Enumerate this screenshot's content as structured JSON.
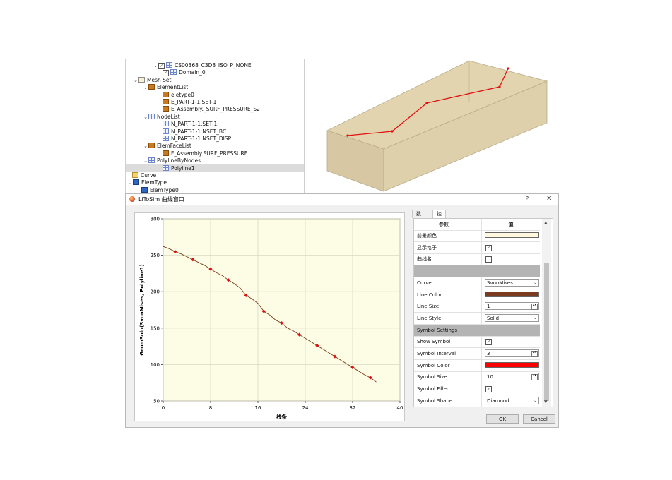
{
  "tree": {
    "items": [
      {
        "label": "CS00368_C3D8_ISO_P_NONE",
        "icon": "grid-icon",
        "checked": true,
        "expanded": true
      },
      {
        "label": "Domain_0",
        "icon": "grid-icon",
        "checked": true
      },
      {
        "label": "Mesh Set",
        "icon": "folder-icon",
        "expanded": true
      },
      {
        "label": "ElementList",
        "icon": "book-icon",
        "expanded": true
      },
      {
        "label": "eletype0",
        "icon": "book-icon"
      },
      {
        "label": "E_PART-1-1.SET-1",
        "icon": "book-icon"
      },
      {
        "label": "E_Assembly._SURF_PRESSURE_S2",
        "icon": "book-icon"
      },
      {
        "label": "NodeList",
        "icon": "grid-icon",
        "expanded": true
      },
      {
        "label": "N_PART-1-1.SET-1",
        "icon": "grid-icon"
      },
      {
        "label": "N_PART-1-1.NSET_BC",
        "icon": "grid-icon"
      },
      {
        "label": "N_PART-1-1.NSET_DISP",
        "icon": "grid-icon"
      },
      {
        "label": "ElemFaceList",
        "icon": "book-icon",
        "expanded": true
      },
      {
        "label": "F_Assembly.SURF_PRESSURE",
        "icon": "book-icon"
      },
      {
        "label": "PolylineByNodes",
        "icon": "grid-icon",
        "expanded": true
      },
      {
        "label": "Polyline1",
        "icon": "grid-icon",
        "selected": true
      },
      {
        "label": "Curve",
        "icon": "curve-icon"
      },
      {
        "label": "ElemType",
        "icon": "elem-icon",
        "expanded": true
      },
      {
        "label": "ElemType0",
        "icon": "elem-icon"
      }
    ]
  },
  "dialog": {
    "title": "LiToSim 曲线窗口",
    "help": "?",
    "close": "✕",
    "ok_label": "OK",
    "cancel_label": "Cancel"
  },
  "tabs": [
    {
      "label": "数据",
      "active": false
    },
    {
      "label": "控制",
      "active": true
    }
  ],
  "props": {
    "header_param": "参数",
    "header_value": "值",
    "rows": [
      {
        "name": "前景颜色",
        "kind": "color",
        "value": "#fff7de"
      },
      {
        "name": "显示格子",
        "kind": "check",
        "checked": true
      },
      {
        "name": "曲线名",
        "kind": "check",
        "checked": false
      },
      {
        "name": "",
        "kind": "section"
      },
      {
        "name": "Curve",
        "kind": "combo",
        "value": "SvonMises"
      },
      {
        "name": "Line Color",
        "kind": "color",
        "value": "#7a3b1e"
      },
      {
        "name": "Line Size",
        "kind": "spin",
        "value": "1"
      },
      {
        "name": "Line Style",
        "kind": "combo",
        "value": "Solid"
      },
      {
        "name": "Symbol Settings",
        "kind": "section"
      },
      {
        "name": "Show Symbol",
        "kind": "check",
        "checked": true
      },
      {
        "name": "Symbol Interval",
        "kind": "spin",
        "value": "3"
      },
      {
        "name": "Symbol Color",
        "kind": "color",
        "value": "#ff0000"
      },
      {
        "name": "Symbol Size",
        "kind": "spin",
        "value": "10"
      },
      {
        "name": "Symbol Filled",
        "kind": "check",
        "checked": true
      },
      {
        "name": "Symbol Shape",
        "kind": "combo",
        "value": "Diamond"
      }
    ]
  },
  "colors": {
    "plot_background": "#fdfde6",
    "line": "#7a3b1e",
    "marker": "#e01010",
    "box_face": "#e3d4b0",
    "polyline": "#e01010"
  },
  "chart_data": {
    "type": "line",
    "xlabel": "线条",
    "ylabel": "GeomSolu(SvonMises, Polyline1)",
    "xlim": [
      0,
      40
    ],
    "ylim": [
      50,
      300
    ],
    "xticks": [
      "0",
      "8",
      "16",
      "24",
      "32",
      "40"
    ],
    "yticks": [
      "50",
      "100",
      "150",
      "200",
      "250",
      "300"
    ],
    "grid": true,
    "series": [
      {
        "x": [
          0,
          1,
          2,
          3,
          4,
          5,
          6,
          7,
          8,
          9,
          10,
          11,
          12,
          13,
          14,
          15,
          16,
          17,
          18,
          19,
          20,
          21,
          22,
          23,
          24,
          25,
          26,
          27,
          28,
          29,
          30,
          31,
          32,
          33,
          34,
          35,
          36
        ],
        "y": [
          262,
          259,
          255,
          252,
          248,
          244,
          240,
          236,
          231,
          226,
          222,
          216,
          211,
          205,
          195,
          190,
          184,
          173,
          168,
          161,
          157,
          150,
          146,
          141,
          136,
          131,
          126,
          121,
          116,
          111,
          106,
          101,
          96,
          91,
          86,
          82,
          76
        ]
      }
    ],
    "marker_x": [
      2,
      5,
      8,
      11,
      14,
      17,
      20,
      23,
      26,
      29,
      32,
      35
    ],
    "marker_y": [
      255,
      244,
      231,
      216,
      195,
      173,
      157,
      141,
      126,
      111,
      96,
      82
    ]
  }
}
